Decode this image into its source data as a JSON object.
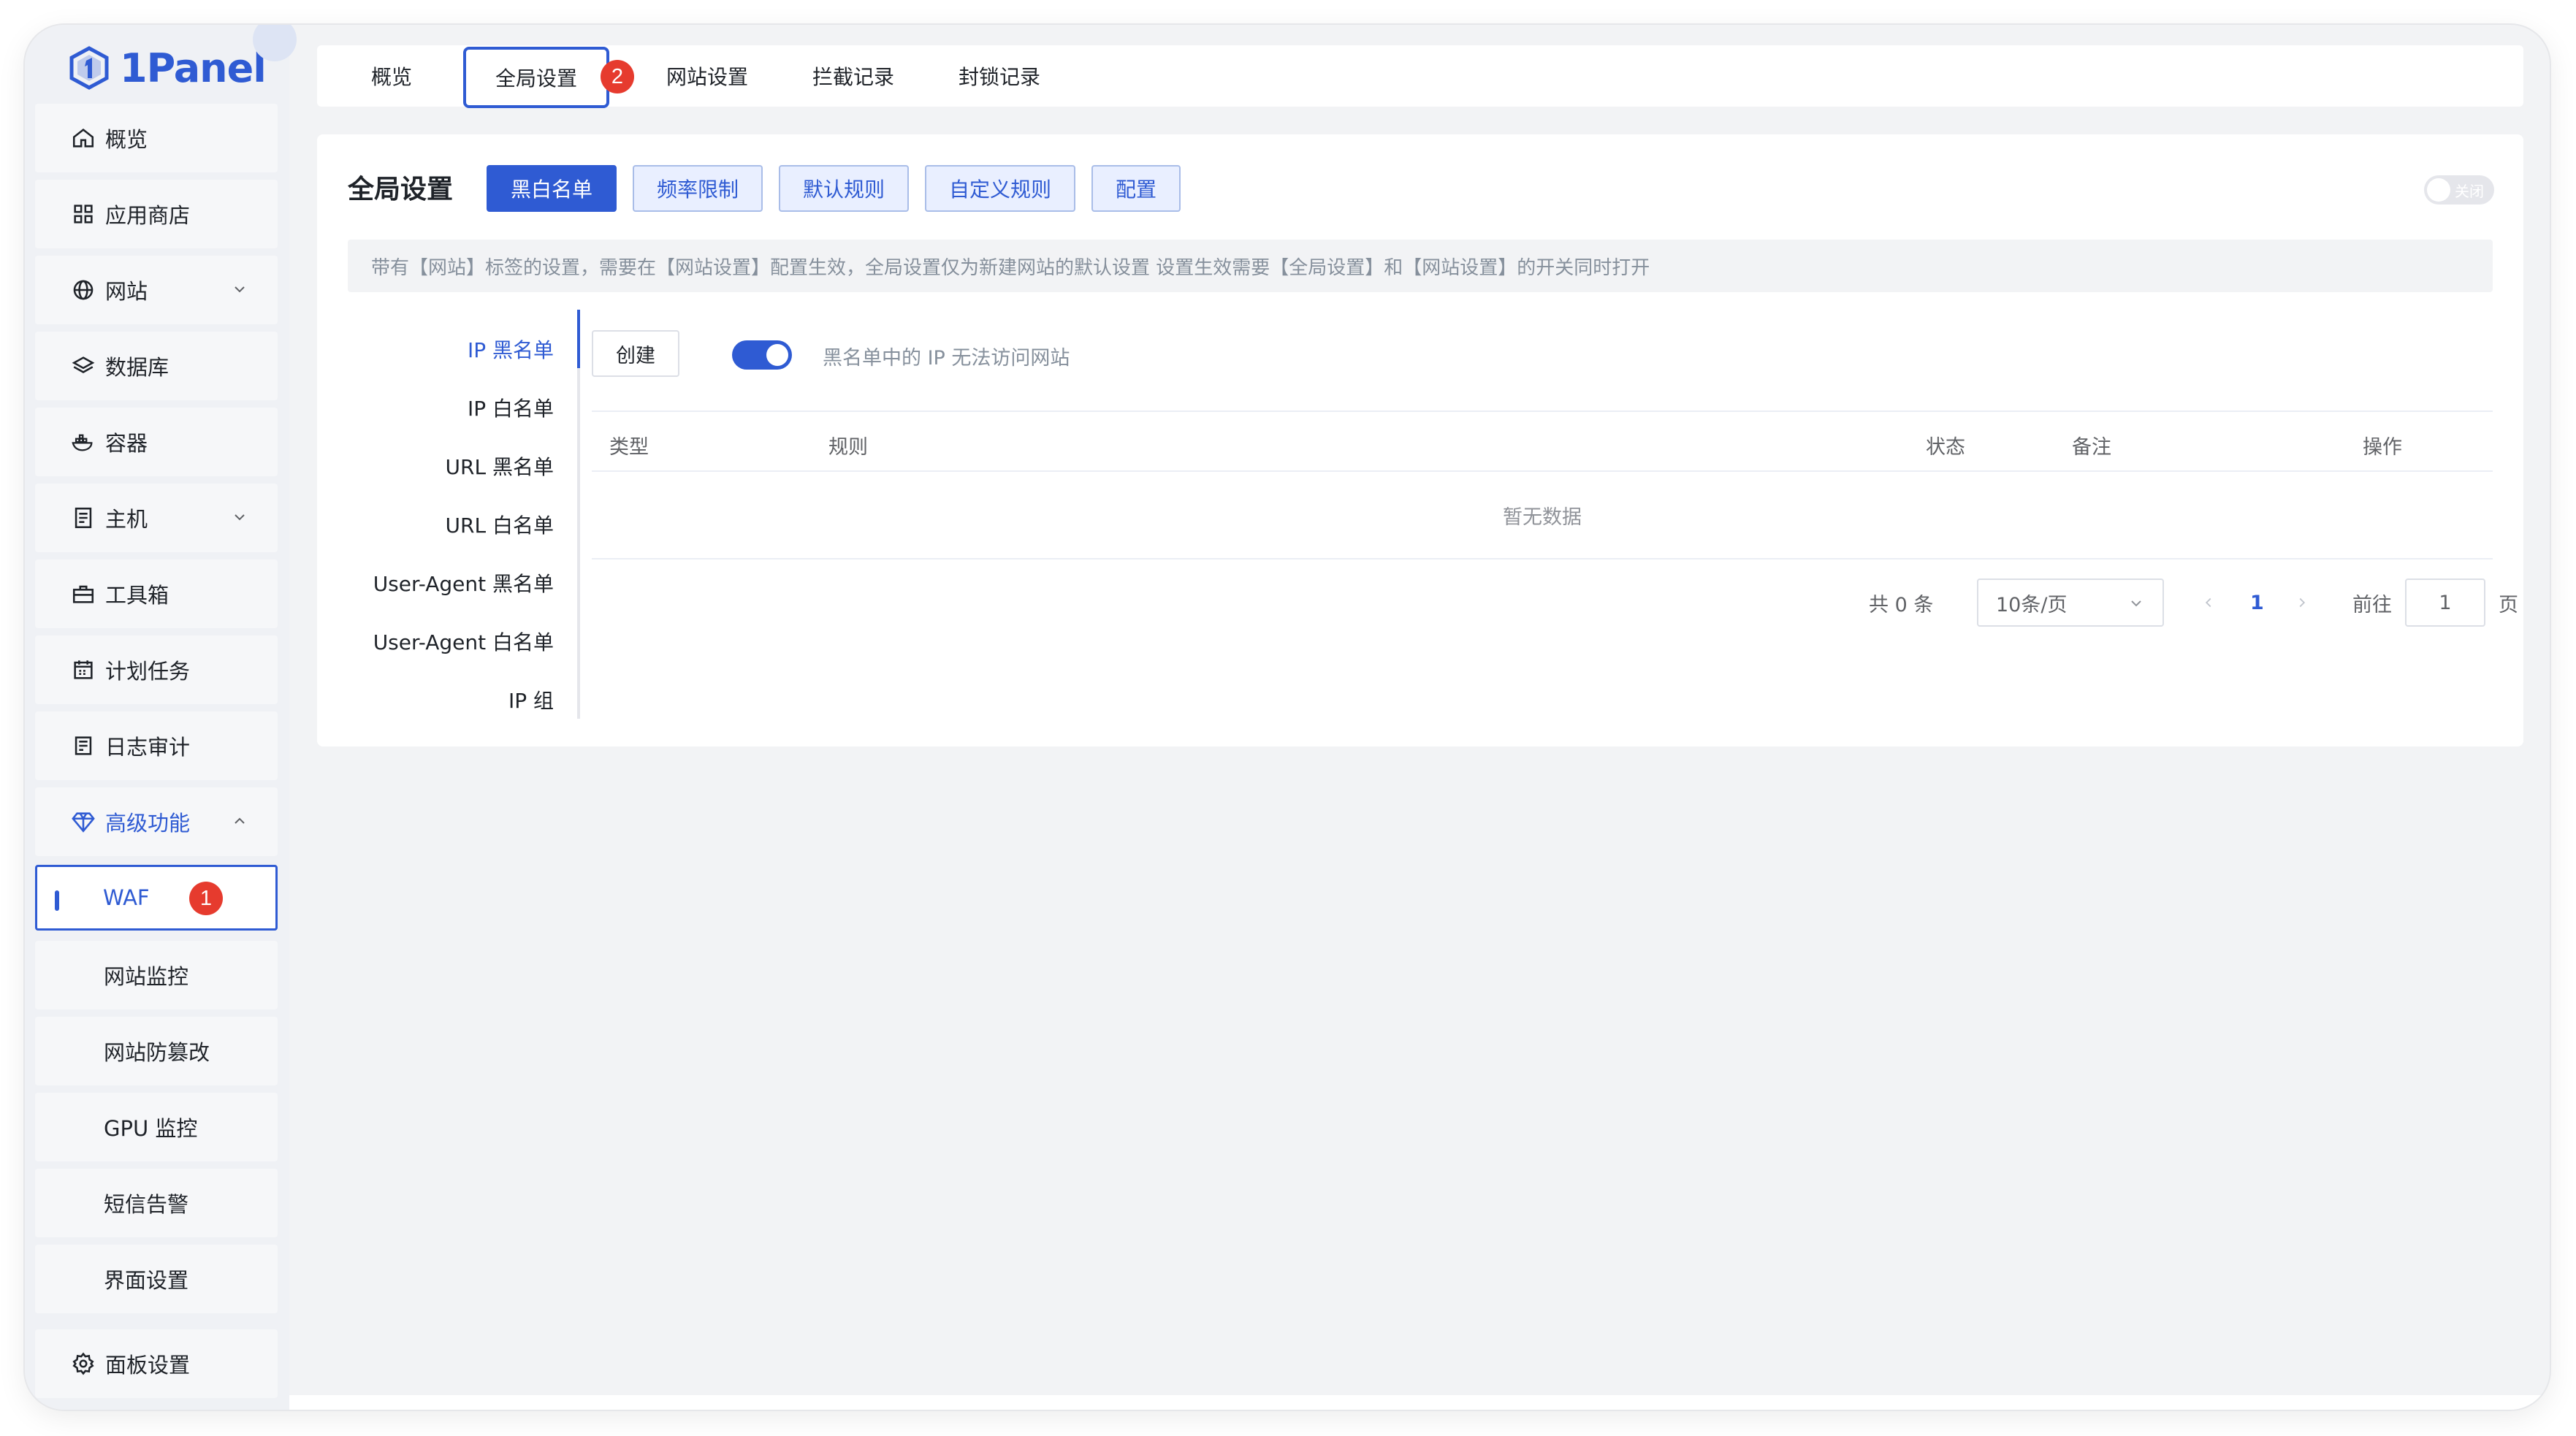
{
  "app": {
    "logo_text": "1Panel"
  },
  "sidebar": {
    "items": [
      {
        "label": "概览",
        "icon": "home-icon"
      },
      {
        "label": "应用商店",
        "icon": "grid-icon"
      },
      {
        "label": "网站",
        "icon": "globe-icon"
      },
      {
        "label": "数据库",
        "icon": "layers-icon"
      },
      {
        "label": "容器",
        "icon": "docker-icon"
      },
      {
        "label": "主机",
        "icon": "server-icon"
      },
      {
        "label": "工具箱",
        "icon": "toolbox-icon"
      },
      {
        "label": "计划任务",
        "icon": "calendar-icon"
      },
      {
        "label": "日志审计",
        "icon": "log-icon"
      },
      {
        "label": "高级功能",
        "icon": "diamond-icon"
      }
    ],
    "submenu": [
      "WAF",
      "网站监控",
      "网站防篡改",
      "GPU 监控",
      "短信告警",
      "界面设置"
    ],
    "footer_item": {
      "label": "面板设置",
      "icon": "gear-icon"
    }
  },
  "annotations": {
    "step1": "1",
    "step2": "2"
  },
  "tabs": [
    "概览",
    "全局设置",
    "网站设置",
    "拦截记录",
    "封锁记录"
  ],
  "card": {
    "title": "全局设置",
    "pills": [
      "黑白名单",
      "频率限制",
      "默认规则",
      "自定义规则",
      "配置"
    ],
    "toggle_label": "关闭",
    "notice": "带有【网站】标签的设置，需要在【网站设置】配置生效，全局设置仅为新建网站的默认设置 设置生效需要【全局设置】和【网站设置】的开关同时打开"
  },
  "rule_list": [
    "IP 黑名单",
    "IP 白名单",
    "URL 黑名单",
    "URL 白名单",
    "User-Agent 黑名单",
    "User-Agent 白名单",
    "IP 组"
  ],
  "toolbar": {
    "create_label": "创建",
    "switch_label": "黑名单中的 IP 无法访问网站"
  },
  "table": {
    "columns": [
      "类型",
      "规则",
      "状态",
      "备注",
      "操作"
    ],
    "empty_text": "暂无数据"
  },
  "pagination": {
    "total": "共 0 条",
    "page_size": "10条/页",
    "current_page": "1",
    "goto_label": "前往",
    "goto_value": "1",
    "page_suffix": "页"
  },
  "colors": {
    "accent": "#2f5bd3",
    "badge": "#e63b2e",
    "background": "#f2f3f5"
  }
}
